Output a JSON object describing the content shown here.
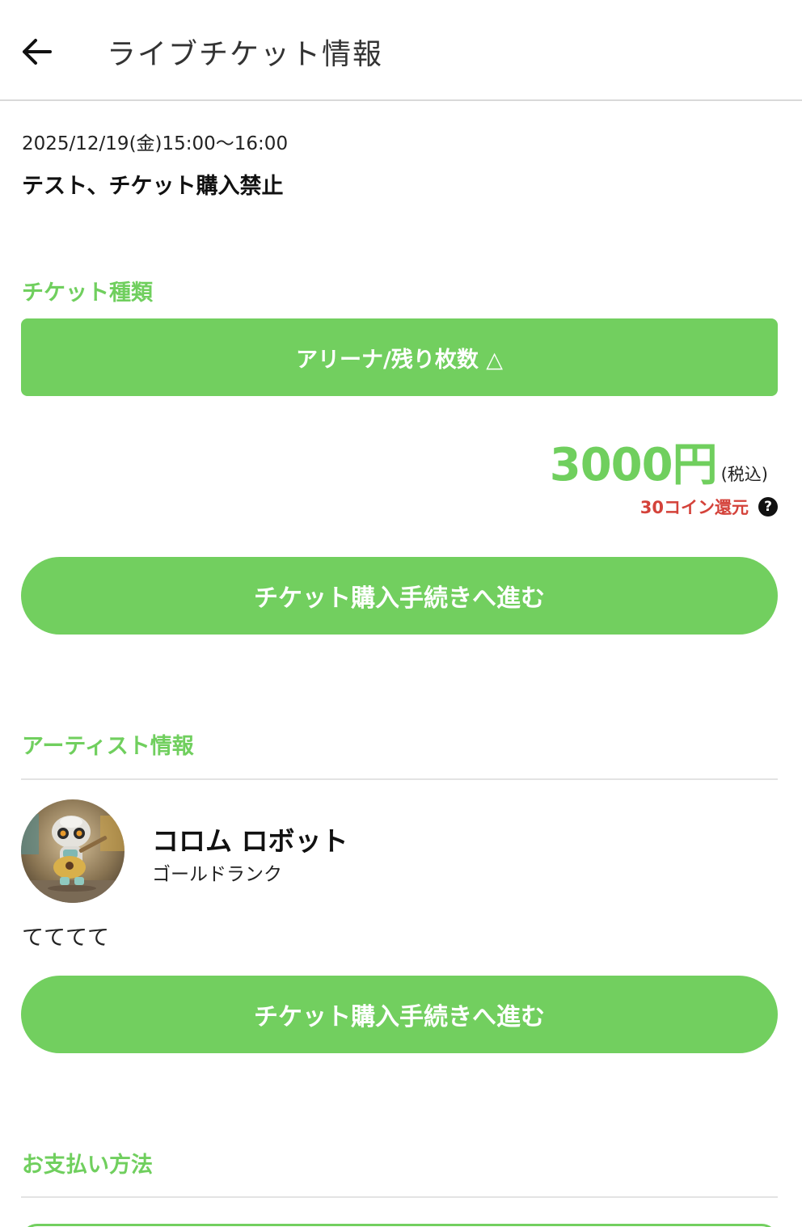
{
  "header": {
    "title": "ライブチケット情報"
  },
  "event": {
    "datetime": "2025/12/19(金)15:00〜16:00",
    "name": "テスト、チケット購入禁止"
  },
  "ticket": {
    "section_heading": "チケット種類",
    "type_label": "アリーナ/残り枚数 △",
    "price_amount": "3000",
    "price_unit": "円",
    "tax_note": "(税込)",
    "coin_return": "30コイン還元",
    "proceed_label": "チケット購入手続きへ進む"
  },
  "artist": {
    "section_heading": "アーティスト情報",
    "name": "コロム ロボット",
    "rank": "ゴールドランク",
    "description": "てててて",
    "proceed_label": "チケット購入手続きへ進む"
  },
  "payment": {
    "section_heading": "お支払い方法"
  },
  "colors": {
    "accent": "#72cf5f",
    "accent_text": "#70cf5e",
    "coin_red": "#d4423a"
  },
  "icons": {
    "back": "arrow-left-icon",
    "help": "question-circle-icon"
  }
}
